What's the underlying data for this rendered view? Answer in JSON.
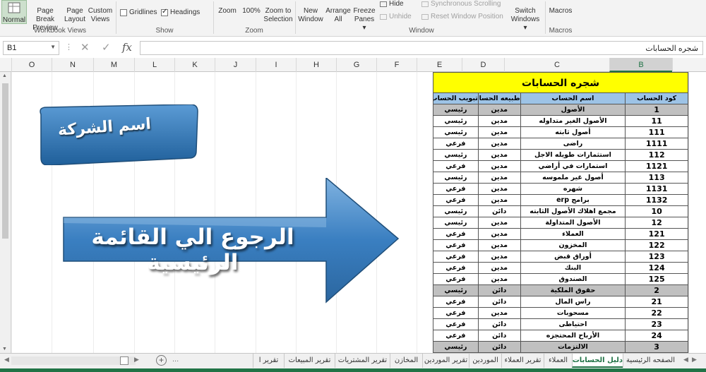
{
  "ribbon": {
    "workbook_views": {
      "group_label": "Workbook Views",
      "normal": "Normal",
      "page_break_preview": [
        "Page Break",
        "Preview"
      ],
      "page_layout": [
        "Page",
        "Layout"
      ],
      "custom_views": [
        "Custom",
        "Views"
      ]
    },
    "show": {
      "group_label": "Show",
      "gridlines": "Gridlines",
      "headings": "Headings"
    },
    "zoom": {
      "group_label": "Zoom",
      "zoom": "Zoom",
      "hundred": "100%",
      "zoom_to_selection": [
        "Zoom to",
        "Selection"
      ]
    },
    "window": {
      "group_label": "Window",
      "new_window": [
        "New",
        "Window"
      ],
      "arrange_all": [
        "Arrange",
        "All"
      ],
      "freeze_panes": [
        "Freeze",
        "Panes ▾"
      ],
      "hide": "Hide",
      "unhide": "Unhide",
      "sync_scrolling": "Synchronous Scrolling",
      "reset_window_position": "Reset Window Position",
      "switch_windows": [
        "Switch",
        "Windows ▾"
      ]
    },
    "macros": {
      "group_label": "Macros",
      "macros": "Macros"
    }
  },
  "formula_bar": {
    "name_box": "B1",
    "content": "شجره الحسابات"
  },
  "columns": [
    "O",
    "N",
    "M",
    "L",
    "K",
    "J",
    "I",
    "H",
    "G",
    "F",
    "E",
    "D",
    "C",
    "B"
  ],
  "shapes": {
    "company_name": "اسم الشركة",
    "back_to_main": "الرجوع الي القائمة الرئيسية"
  },
  "accounts": {
    "title": "شجره الحسابات",
    "headers": {
      "code": "كود الحساب",
      "name": "اسم الحساب",
      "nature": "طبيعه الحساب",
      "classification": "تبويب الحساب"
    },
    "rows": [
      {
        "code": "1",
        "name": "الأصول",
        "nature": "مدين",
        "type": "رئيسي",
        "major": true
      },
      {
        "code": "11",
        "name": "الأصول الغير متداوله",
        "nature": "مدين",
        "type": "رئيسي",
        "major": false
      },
      {
        "code": "111",
        "name": "أصول ثابته",
        "nature": "مدين",
        "type": "رئيسي",
        "major": false
      },
      {
        "code": "1111",
        "name": "راضى",
        "nature": "مدين",
        "type": "فرعي",
        "major": false
      },
      {
        "code": "112",
        "name": "استثمارات طويله الاجل",
        "nature": "مدين",
        "type": "رئيسي",
        "major": false
      },
      {
        "code": "1121",
        "name": "استمارات في أراضي",
        "nature": "مدين",
        "type": "فرعي",
        "major": false
      },
      {
        "code": "113",
        "name": "أصول غير ملموسه",
        "nature": "مدين",
        "type": "رئيسي",
        "major": false
      },
      {
        "code": "1131",
        "name": "شهره",
        "nature": "مدين",
        "type": "فرعي",
        "major": false
      },
      {
        "code": "1132",
        "name": "برامج erp",
        "nature": "مدين",
        "type": "فرعي",
        "major": false
      },
      {
        "code": "10",
        "name": "مجمع اهلاك الأصول الثابته",
        "nature": "دائن",
        "type": "رئيسي",
        "major": false
      },
      {
        "code": "12",
        "name": "الأصول المتداولة",
        "nature": "مدين",
        "type": "رئيسي",
        "major": false
      },
      {
        "code": "121",
        "name": "العملاء",
        "nature": "مدين",
        "type": "فرعي",
        "major": false
      },
      {
        "code": "122",
        "name": "المخزون",
        "nature": "مدين",
        "type": "فرعي",
        "major": false
      },
      {
        "code": "123",
        "name": "أوراق قبض",
        "nature": "مدين",
        "type": "فرعي",
        "major": false
      },
      {
        "code": "124",
        "name": "البنك",
        "nature": "مدين",
        "type": "فرعي",
        "major": false
      },
      {
        "code": "125",
        "name": "الصندوق",
        "nature": "مدين",
        "type": "فرعي",
        "major": false
      },
      {
        "code": "2",
        "name": "حقوق الملكية",
        "nature": "دائن",
        "type": "رئيسي",
        "major": true
      },
      {
        "code": "21",
        "name": "راس المال",
        "nature": "دائن",
        "type": "فرعي",
        "major": false
      },
      {
        "code": "22",
        "name": "مسحوبات",
        "nature": "مدين",
        "type": "فرعي",
        "major": false
      },
      {
        "code": "23",
        "name": "احتياطى",
        "nature": "دائن",
        "type": "فرعي",
        "major": false
      },
      {
        "code": "24",
        "name": "الأرباح المحتجزه",
        "nature": "دائن",
        "type": "فرعي",
        "major": false
      },
      {
        "code": "3",
        "name": "الالتزمات",
        "nature": "دائن",
        "type": "رئيسي",
        "major": true
      }
    ]
  },
  "sheet_tabs": [
    {
      "label": "الصفحه الرئيسية",
      "active": false
    },
    {
      "label": "دليل الحسابات",
      "active": true
    },
    {
      "label": "العملاء",
      "active": false
    },
    {
      "label": "تقرير العملاء",
      "active": false
    },
    {
      "label": "الموردين",
      "active": false
    },
    {
      "label": "تقرير الموردين",
      "active": false
    },
    {
      "label": "المخازن",
      "active": false
    },
    {
      "label": "تقرير المشتريات",
      "active": false
    },
    {
      "label": "تقرير المبيعات",
      "active": false
    },
    {
      "label": "تقرير ا",
      "active": false
    }
  ],
  "tab_overflow": "...",
  "colors": {
    "accent": "#217346",
    "title_fill": "#ffff00",
    "header_fill": "#9dc3e6",
    "major_fill": "#c0c0c0",
    "shape_blue": "#2e75b6"
  }
}
